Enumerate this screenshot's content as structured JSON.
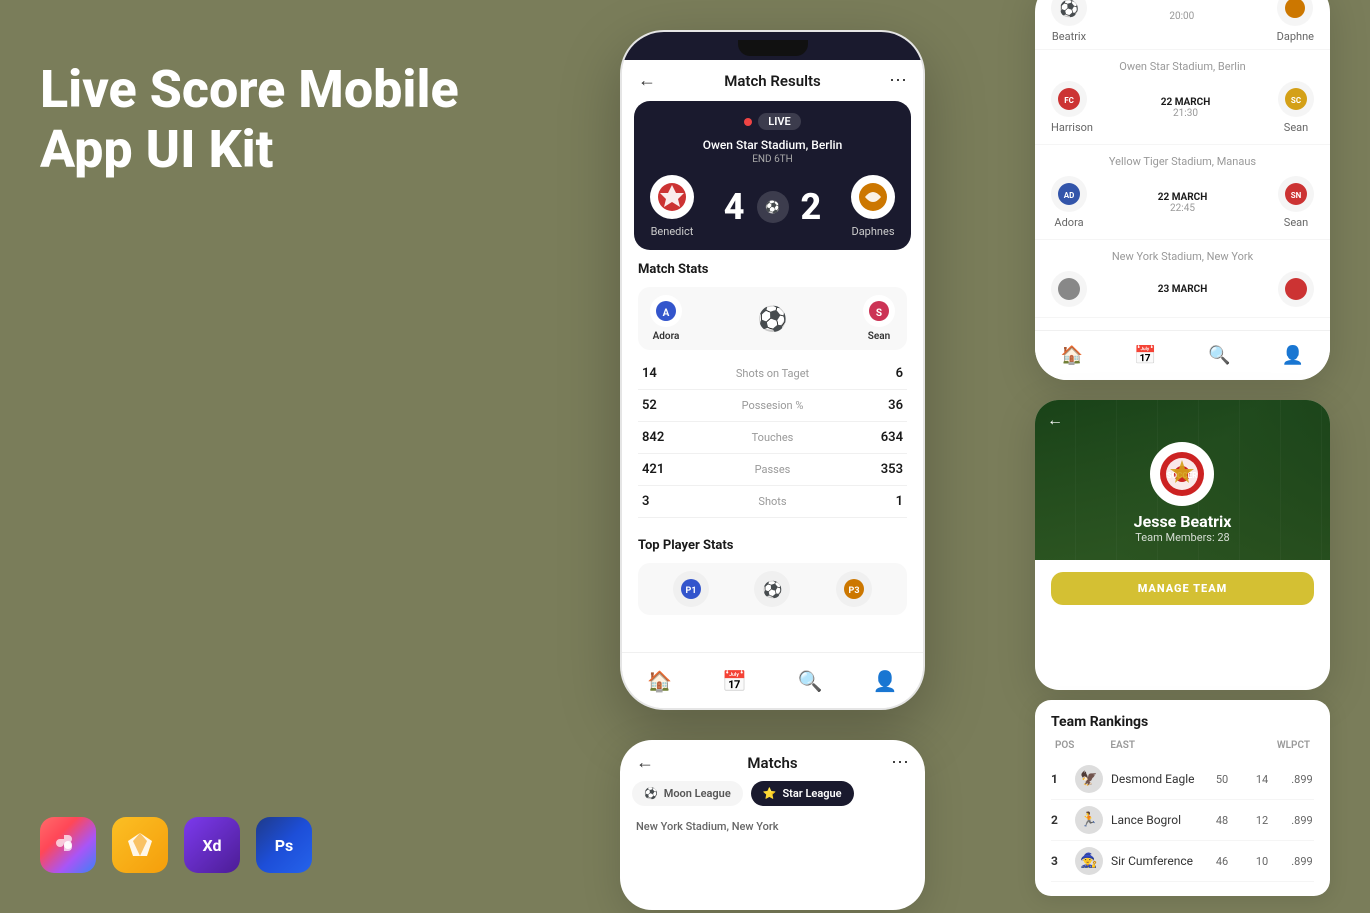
{
  "app": {
    "title": "Live Score Mobile App UI Kit",
    "bg_color": "#7a7d5a"
  },
  "tool_icons": [
    {
      "name": "Figma",
      "symbol": "✦"
    },
    {
      "name": "Sketch",
      "symbol": "⬡"
    },
    {
      "name": "XD",
      "symbol": "Xd"
    },
    {
      "name": "Ps",
      "symbol": "Ps"
    }
  ],
  "main_phone": {
    "title": "Match Results",
    "live_card": {
      "live_label": "LIVE",
      "stadium": "Owen Star Stadium, Berlin",
      "period": "END 6TH",
      "team_home": "Benedict",
      "team_away": "Daphnes",
      "score_home": "4",
      "score_away": "2"
    },
    "match_stats": {
      "title": "Match Stats",
      "team_left": "Adora",
      "team_right": "Sean",
      "rows": [
        {
          "label": "Shots on Taget",
          "left": "14",
          "right": "6"
        },
        {
          "label": "Possesion %",
          "left": "52",
          "right": "36"
        },
        {
          "label": "Touches",
          "left": "842",
          "right": "634"
        },
        {
          "label": "Passes",
          "left": "421",
          "right": "353"
        },
        {
          "label": "Shots",
          "left": "3",
          "right": "1"
        }
      ]
    },
    "top_player_stats": {
      "title": "Top Player Stats"
    },
    "nav": [
      "🏠",
      "📅",
      "🔍",
      "👤"
    ]
  },
  "right_phone": {
    "matches": [
      {
        "stadium": "Owen Star Stadium, Berlin",
        "team_left": "Harrison",
        "team_right": "Sean",
        "date": "22 MARCH",
        "time": "21:30"
      },
      {
        "stadium": "Yellow Tiger Stadium, Manaus",
        "team_left": "Adora",
        "team_right": "Sean",
        "date": "22 MARCH",
        "time": "22:45"
      },
      {
        "stadium": "New York Stadium, New York",
        "team_left": "",
        "team_right": "",
        "date": "23 MARCH",
        "time": ""
      }
    ],
    "prev_match": {
      "team_left": "Beatrix",
      "team_right": "Daphne",
      "time": "20:00"
    },
    "nav": [
      "🏠",
      "📅",
      "🔍",
      "👤"
    ]
  },
  "team_card": {
    "team_name": "Jesse Beatrix",
    "members_label": "Team Members: 28",
    "manage_btn": "MANAGE TEAM"
  },
  "rankings": {
    "title": "Team Rankings",
    "headers": [
      "POS",
      "EAST",
      "W",
      "L",
      "PCT"
    ],
    "rows": [
      {
        "pos": "1",
        "name": "Desmond Eagle",
        "w": "50",
        "l": "14",
        "pct": ".899"
      },
      {
        "pos": "2",
        "name": "Lance Bogrol",
        "w": "48",
        "l": "12",
        "pct": ".899"
      },
      {
        "pos": "3",
        "name": "Sir Cumference",
        "w": "46",
        "l": "10",
        "pct": ".899"
      }
    ]
  },
  "bottom_phone": {
    "title": "Matchs",
    "leagues": [
      {
        "name": "Moon League",
        "active": false
      },
      {
        "name": "Star League",
        "active": true
      }
    ],
    "stadium_label": "New York Stadium, New York"
  }
}
